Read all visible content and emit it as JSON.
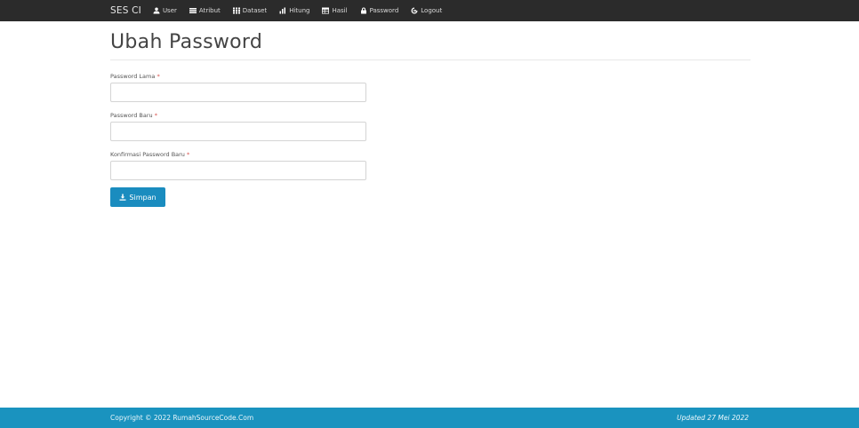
{
  "navbar": {
    "brand": "SES CI",
    "items": [
      {
        "label": "User",
        "icon": "user-icon"
      },
      {
        "label": "Atribut",
        "icon": "list-icon"
      },
      {
        "label": "Dataset",
        "icon": "grid-icon"
      },
      {
        "label": "Hitung",
        "icon": "stats-icon"
      },
      {
        "label": "Hasil",
        "icon": "table-icon"
      },
      {
        "label": "Password",
        "icon": "lock-icon"
      },
      {
        "label": "Logout",
        "icon": "logout-icon"
      }
    ]
  },
  "page": {
    "title": "Ubah Password"
  },
  "form": {
    "old_password_label": "Password Lama",
    "new_password_label": "Password Baru",
    "confirm_password_label": "Konfirmasi Password Baru",
    "required_mark": "*",
    "old_password_value": "",
    "new_password_value": "",
    "confirm_password_value": "",
    "submit_label": "Simpan",
    "submit_icon": "download-icon"
  },
  "footer": {
    "copyright": "Copyright © 2022 RumahSourceCode.Com",
    "updated": "Updated 27 Mei 2022"
  },
  "colors": {
    "navbar_bg": "#2b2b2b",
    "accent": "#1a8cbf",
    "footer_bg": "#1a93bf",
    "required": "#d9534f"
  }
}
